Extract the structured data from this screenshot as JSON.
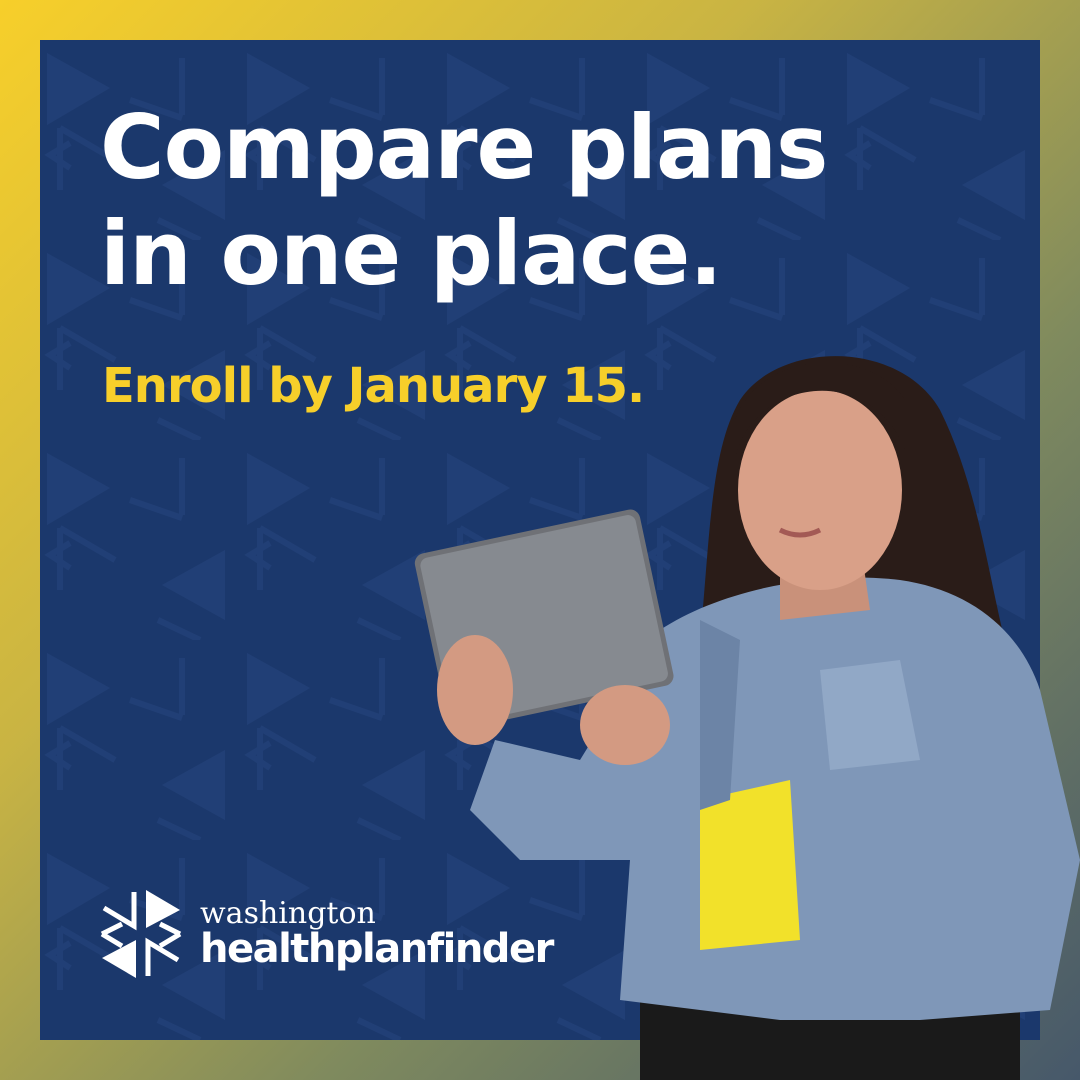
{
  "headline": {
    "line1": "Compare plans",
    "line2": "in one place."
  },
  "subheadline": "Enroll by January 15.",
  "logo": {
    "top": "washington",
    "bottom": "healthplanfinder"
  },
  "colors": {
    "panel": "#1b386c",
    "accent": "#f7cf2a",
    "text": "#ffffff",
    "border_start": "#f7cf2a",
    "border_end": "#46586a"
  },
  "image": {
    "subject": "woman-holding-tablet"
  }
}
